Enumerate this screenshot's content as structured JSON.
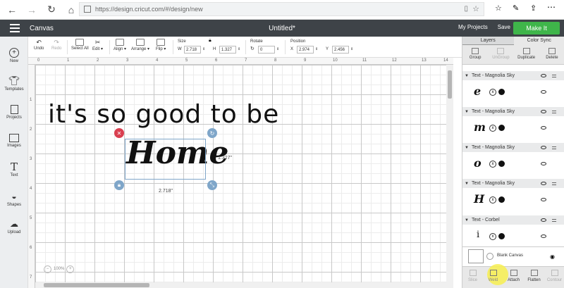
{
  "browser": {
    "url": "https://design.cricut.com/#/design/new"
  },
  "header": {
    "app_title": "Canvas",
    "doc_title": "Untitled*",
    "my_projects": "My Projects",
    "save": "Save",
    "make_it": "Make It"
  },
  "toolbar": {
    "undo": "Undo",
    "redo": "Redo",
    "select_all": "Select All",
    "edit": "Edit ▾",
    "align": "Align ▾",
    "arrange": "Arrange ▾",
    "flip": "Flip ▾",
    "size_label": "Size",
    "w_label": "W",
    "w_value": "2.718",
    "h_label": "H",
    "h_value": "1.327",
    "rotate_label": "Rotate",
    "rotate_value": "0",
    "position_label": "Position",
    "x_label": "X",
    "x_value": "2.974",
    "y_label": "Y",
    "y_value": "2.456"
  },
  "sidebar": {
    "items": [
      {
        "label": "New"
      },
      {
        "label": "Templates"
      },
      {
        "label": "Projects"
      },
      {
        "label": "Images"
      },
      {
        "label": "Text"
      },
      {
        "label": "Shapes"
      },
      {
        "label": "Upload"
      }
    ]
  },
  "canvas": {
    "ruler_top": [
      "0",
      "1",
      "2",
      "3",
      "4",
      "5",
      "6",
      "7",
      "8",
      "9",
      "10",
      "11",
      "12",
      "13",
      "14"
    ],
    "ruler_left": [
      "1",
      "2",
      "3",
      "4",
      "5",
      "6",
      "7"
    ],
    "text_line": "it's so good to be",
    "script_word": "Home",
    "width_dim": "2.718\"",
    "height_dim": "1.327\"",
    "zoom": "100%"
  },
  "panel": {
    "tabs": [
      "Layers",
      "Color Sync"
    ],
    "actions": [
      {
        "label": "Group",
        "enabled": true
      },
      {
        "label": "UnGroup",
        "enabled": false
      },
      {
        "label": "Duplicate",
        "enabled": true
      },
      {
        "label": "Delete",
        "enabled": true
      }
    ],
    "layers": [
      {
        "name": "Text - Magnolia Sky",
        "glyph": "e"
      },
      {
        "name": "Text - Magnolia Sky",
        "glyph": "m"
      },
      {
        "name": "Text - Magnolia Sky",
        "glyph": "o"
      },
      {
        "name": "Text - Magnolia Sky",
        "glyph": "H"
      },
      {
        "name": "Text - Corbel",
        "glyph": "i"
      }
    ],
    "blank_canvas": "Blank Canvas",
    "bottom_actions": [
      {
        "label": "Slice",
        "enabled": false
      },
      {
        "label": "Weld",
        "enabled": true
      },
      {
        "label": "Attach",
        "enabled": true
      },
      {
        "label": "Flatten",
        "enabled": true
      },
      {
        "label": "Contour",
        "enabled": false
      }
    ]
  }
}
